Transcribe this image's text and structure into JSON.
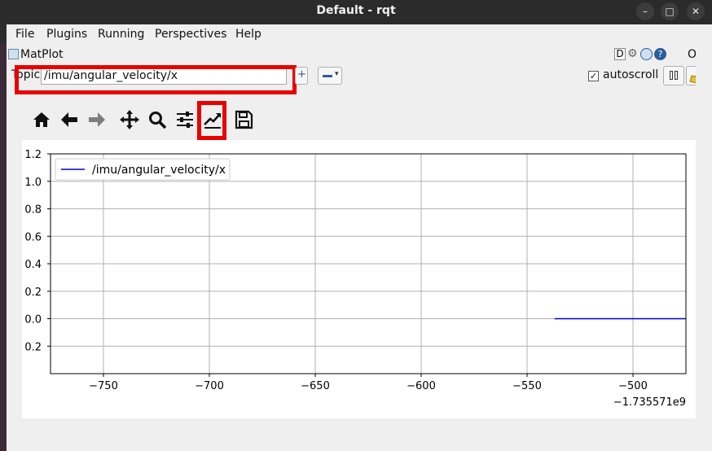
{
  "window": {
    "title": "Default - rqt"
  },
  "menubar": {
    "items": [
      "File",
      "Plugins",
      "Running",
      "Perspectives",
      "Help"
    ]
  },
  "dock": {
    "title": "MatPlot",
    "header_right": "D",
    "close_label": "O"
  },
  "topic": {
    "label": "Topic",
    "value": "/imu/angular_velocity/x"
  },
  "autoscroll": {
    "label": "autoscroll",
    "checked": true
  },
  "toolbar": {
    "icons": [
      "home-icon",
      "back-arrow-icon",
      "forward-arrow-icon",
      "pan-move-icon",
      "zoom-icon",
      "subplot-config-icon",
      "edit-curve-icon",
      "save-icon"
    ]
  },
  "colors": {
    "highlight": "#ea0000",
    "series": "#0000cc"
  },
  "chart_data": {
    "type": "line",
    "series": [
      {
        "name": "/imu/angular_velocity/x",
        "x": [
          -537,
          -475
        ],
        "y": [
          0.0,
          0.0
        ]
      }
    ],
    "xlim": [
      -775,
      -475
    ],
    "ylim": [
      -0.4,
      1.2
    ],
    "xticks": [
      -750,
      -700,
      -650,
      -600,
      -550,
      -500
    ],
    "yticks": [
      -0.2,
      0.0,
      0.2,
      0.4,
      0.6,
      0.8,
      1.0,
      1.2
    ],
    "xtick_labels": [
      "−750",
      "−700",
      "−650",
      "−600",
      "−550",
      "−500"
    ],
    "ytick_labels": [
      "0.2",
      "0.0",
      "0.2",
      "0.4",
      "0.6",
      "0.8",
      "1.0",
      "1.2"
    ],
    "x_offset_label": "−1.735571e9",
    "grid": true,
    "legend_placement": "top-left"
  }
}
